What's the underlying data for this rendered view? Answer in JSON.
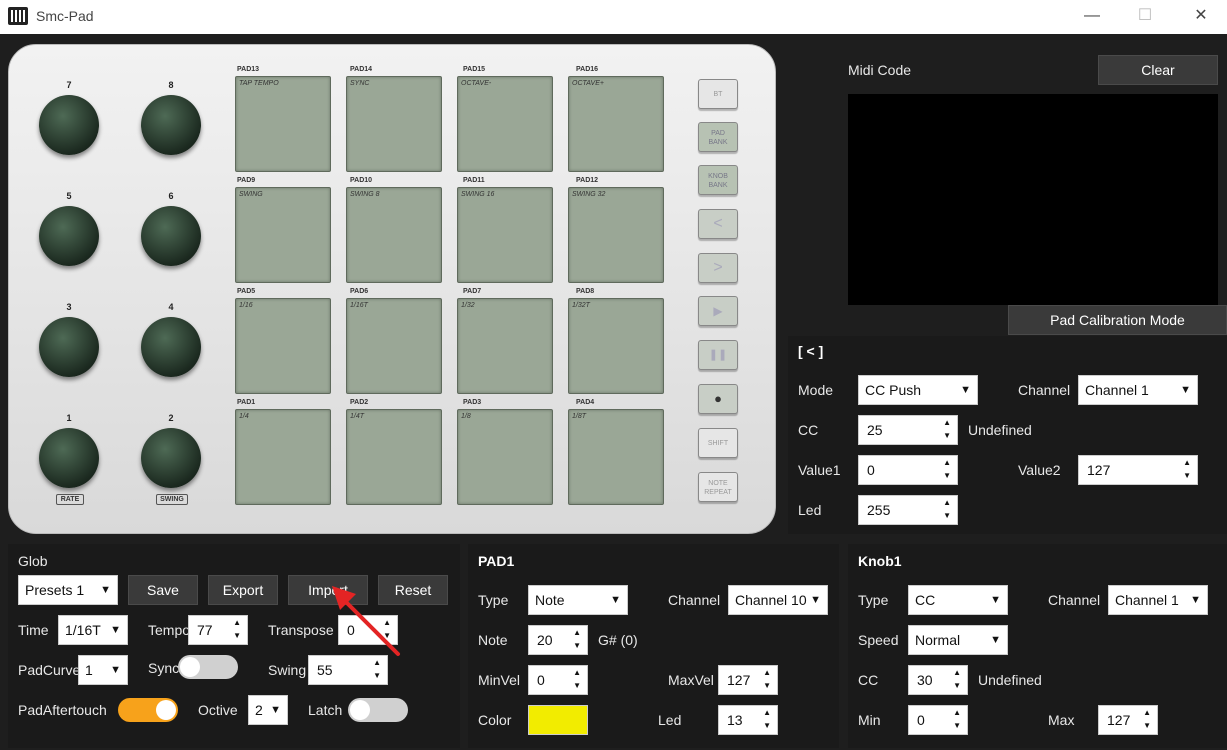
{
  "app": {
    "title": "Smc-Pad",
    "icon": "piano-icon"
  },
  "window_controls": {
    "minimize": "—",
    "maximize": "☐",
    "close": "✕"
  },
  "device": {
    "knobs": [
      {
        "label": "7"
      },
      {
        "label": "8"
      },
      {
        "label": "5"
      },
      {
        "label": "6"
      },
      {
        "label": "3"
      },
      {
        "label": "4"
      },
      {
        "label": "1"
      },
      {
        "label": "2"
      }
    ],
    "knob_tags": [
      "RATE",
      "SWING"
    ],
    "pad_rows": [
      [
        {
          "label": "PAD13",
          "name": "TAP TEMPO"
        },
        {
          "label": "PAD14",
          "name": "SYNC"
        },
        {
          "label": "PAD15",
          "name": "OCTAVE-"
        },
        {
          "label": "PAD16",
          "name": "OCTAVE+"
        }
      ],
      [
        {
          "label": "PAD9",
          "name": "SWING"
        },
        {
          "label": "PAD10",
          "name": "SWING 8"
        },
        {
          "label": "PAD11",
          "name": "SWING 16"
        },
        {
          "label": "PAD12",
          "name": "SWING 32"
        }
      ],
      [
        {
          "label": "PAD5",
          "name": "1/16"
        },
        {
          "label": "PAD6",
          "name": "1/16T"
        },
        {
          "label": "PAD7",
          "name": "1/32"
        },
        {
          "label": "PAD8",
          "name": "1/32T"
        }
      ],
      [
        {
          "label": "PAD1",
          "name": "1/4"
        },
        {
          "label": "PAD2",
          "name": "1/4T"
        },
        {
          "label": "PAD3",
          "name": "1/8"
        },
        {
          "label": "PAD4",
          "name": "1/8T"
        }
      ]
    ],
    "side_buttons": {
      "bt": "BT",
      "pad_bank_1": "PAD",
      "pad_bank_2": "BANK",
      "knob_bank_1": "KNOB",
      "knob_bank_2": "BANK",
      "left": "<",
      "right": ">",
      "play": "▶",
      "pause": "❚❚",
      "record": "●",
      "shift": "SHIFT",
      "note_repeat_1": "NOTE",
      "note_repeat_2": "REPEAT"
    }
  },
  "midi": {
    "title": "Midi Code",
    "clear": "Clear",
    "calibration": "Pad Calibration Mode"
  },
  "button_panel": {
    "title": "[ < ]",
    "mode_label": "Mode",
    "mode_value": "CC Push",
    "channel_label": "Channel",
    "channel_value": "Channel 1",
    "cc_label": "CC",
    "cc_value": "25",
    "cc_name": "Undefined",
    "value1_label": "Value1",
    "value1": "0",
    "value2_label": "Value2",
    "value2": "127",
    "led_label": "Led",
    "led_value": "255"
  },
  "glob": {
    "title": "Glob",
    "presets_value": "Presets 1",
    "save": "Save",
    "export": "Export",
    "import": "Import",
    "reset": "Reset",
    "time_label": "Time",
    "time_value": "1/16T",
    "tempo_label": "Tempo",
    "tempo_value": "77",
    "transpose_label": "Transpose",
    "transpose_value": "0",
    "padcurve_label": "PadCurve",
    "padcurve_value": "1",
    "sync_label": "Sync",
    "sync_on": false,
    "swing_label": "Swing",
    "swing_value": "55",
    "padaftertouch_label": "PadAftertouch",
    "padaftertouch_on": true,
    "octive_label": "Octive",
    "octive_value": "2",
    "latch_label": "Latch",
    "latch_on": false,
    "toggle_on_color": "#f7a21b"
  },
  "pad_panel": {
    "title": "PAD1",
    "type_label": "Type",
    "type_value": "Note",
    "channel_label": "Channel",
    "channel_value": "Channel 10",
    "note_label": "Note",
    "note_value": "20",
    "note_name": "G# (0)",
    "minvel_label": "MinVel",
    "minvel_value": "0",
    "maxvel_label": "MaxVel",
    "maxvel_value": "127",
    "color_label": "Color",
    "color_value": "#f2ec00",
    "led_label": "Led",
    "led_value": "13"
  },
  "knob_panel": {
    "title": "Knob1",
    "type_label": "Type",
    "type_value": "CC",
    "channel_label": "Channel",
    "channel_value": "Channel 1",
    "speed_label": "Speed",
    "speed_value": "Normal",
    "cc_label": "CC",
    "cc_value": "30",
    "cc_name": "Undefined",
    "min_label": "Min",
    "min_value": "0",
    "max_label": "Max",
    "max_value": "127"
  }
}
